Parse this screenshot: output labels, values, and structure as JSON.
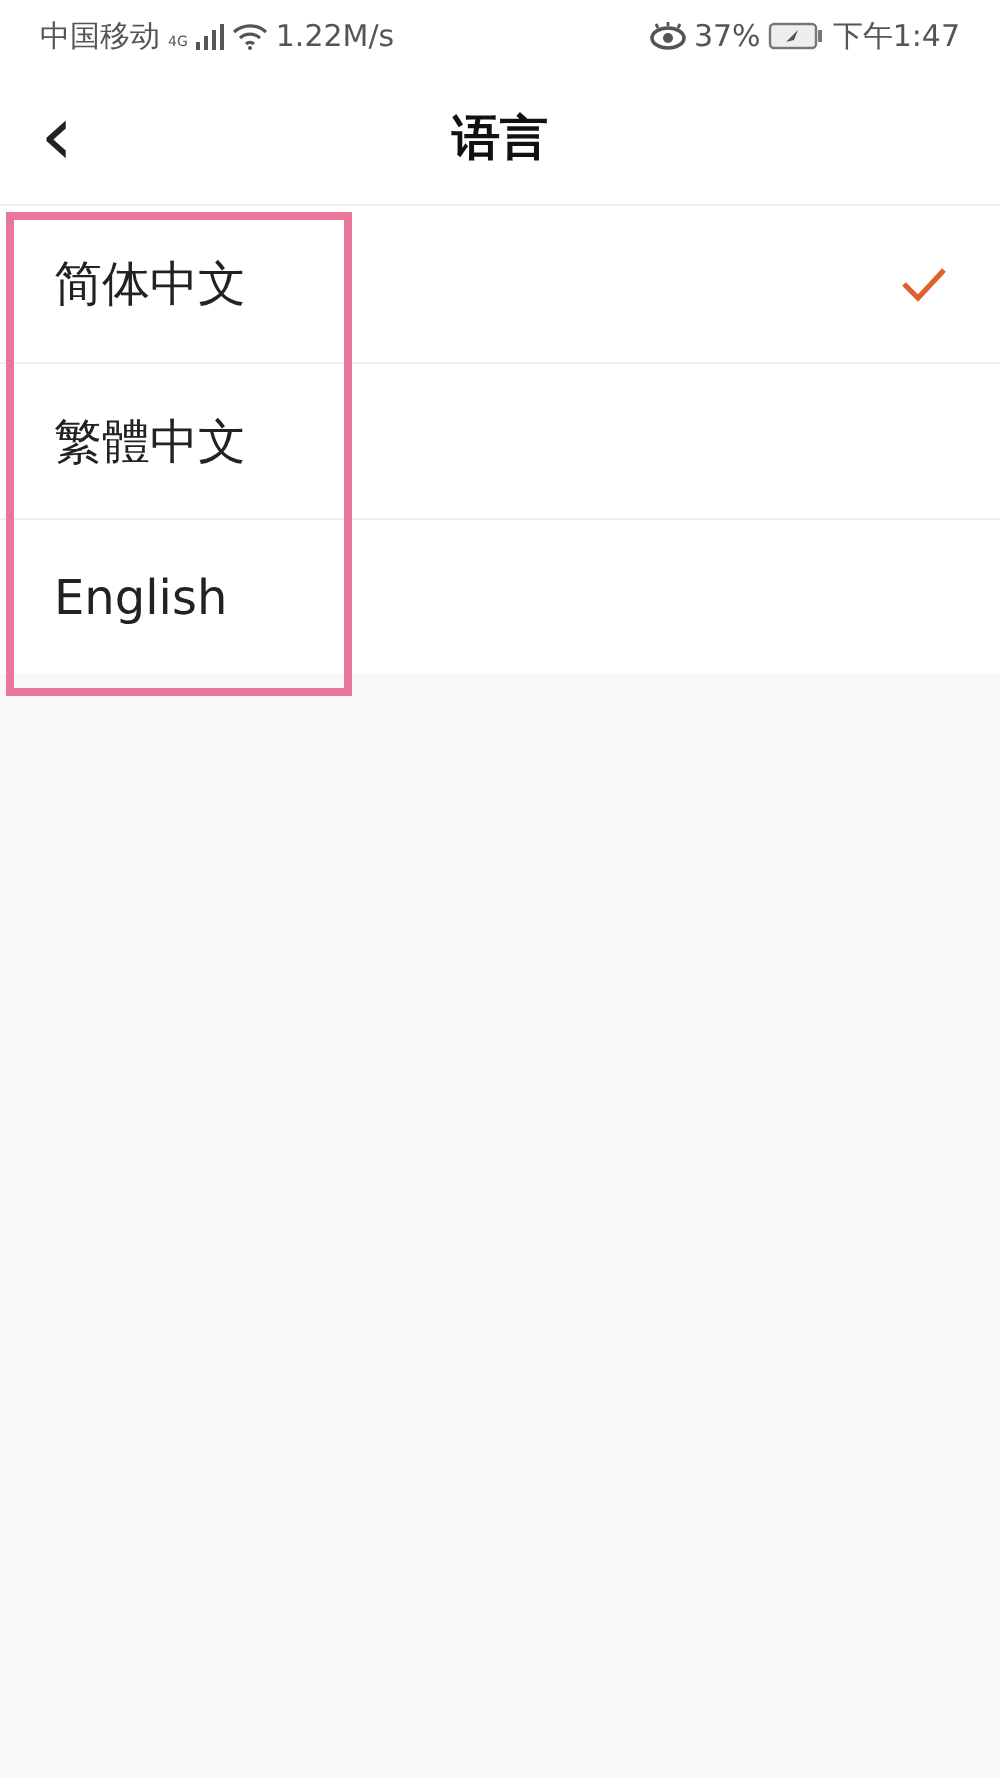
{
  "status_bar": {
    "carrier": "中国移动",
    "network_type": "4G",
    "speed": "1.22M/s",
    "battery": "37%",
    "time": "下午1:47"
  },
  "header": {
    "back": "‹",
    "title": "语言"
  },
  "languages": [
    {
      "label": "简体中文",
      "selected": true
    },
    {
      "label": "繁體中文",
      "selected": false
    },
    {
      "label": "English",
      "selected": false
    }
  ],
  "highlight": {
    "shown": true
  }
}
